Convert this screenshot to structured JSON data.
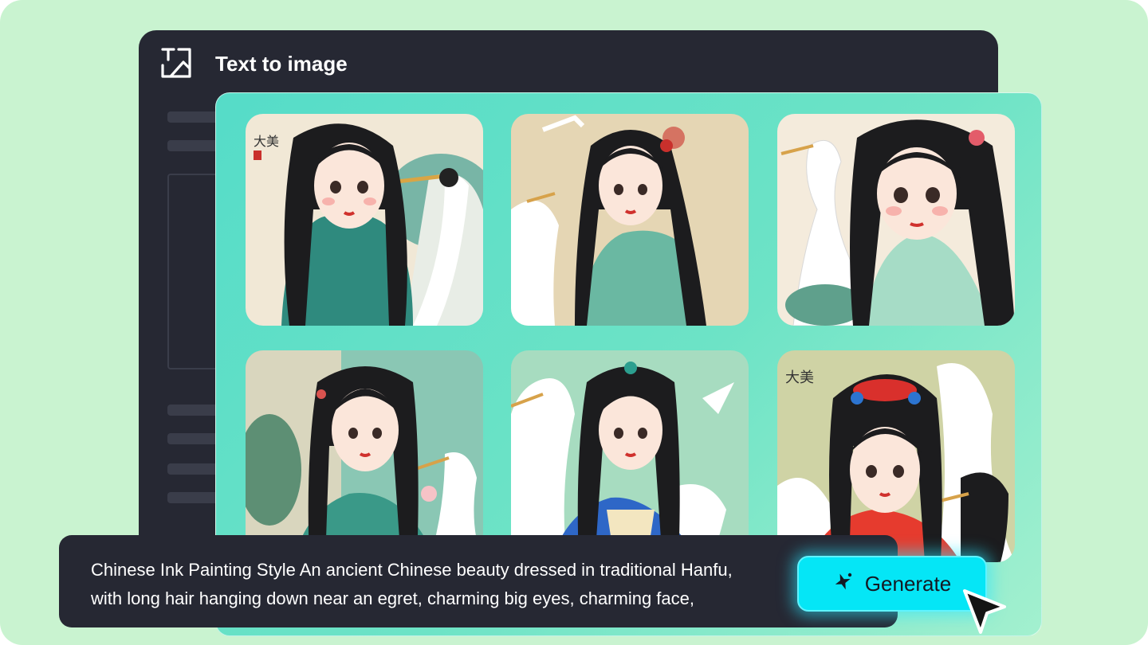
{
  "window": {
    "title": "Text to image",
    "icon": "text-to-image-icon"
  },
  "gallery": {
    "images": [
      {
        "subject": "woman-in-teal-hanfu-with-egret",
        "background": "#f1e8d6"
      },
      {
        "subject": "woman-with-egret-and-flying-crane",
        "background": "#e5d6b4"
      },
      {
        "subject": "woman-beside-white-egret",
        "background": "#f4ebdc"
      },
      {
        "subject": "woman-with-lotus-and-egret",
        "background": "#8ac7b4"
      },
      {
        "subject": "woman-in-blue-robe-with-cranes",
        "background": "#a7dcc0"
      },
      {
        "subject": "woman-with-red-headdress-and-crane",
        "background": "#cfd3a5"
      }
    ]
  },
  "prompt": {
    "line1": "Chinese Ink Painting Style An ancient Chinese beauty dressed in traditional Hanfu,",
    "line2": "with long hair hanging down near an egret, charming big eyes, charming face,"
  },
  "generate_button": {
    "label": "Generate",
    "icon": "sparkle-icon"
  },
  "colors": {
    "background": "#c9f3d0",
    "window": "#262833",
    "accent": "#05e6f6",
    "panel": "#55dcc8"
  }
}
